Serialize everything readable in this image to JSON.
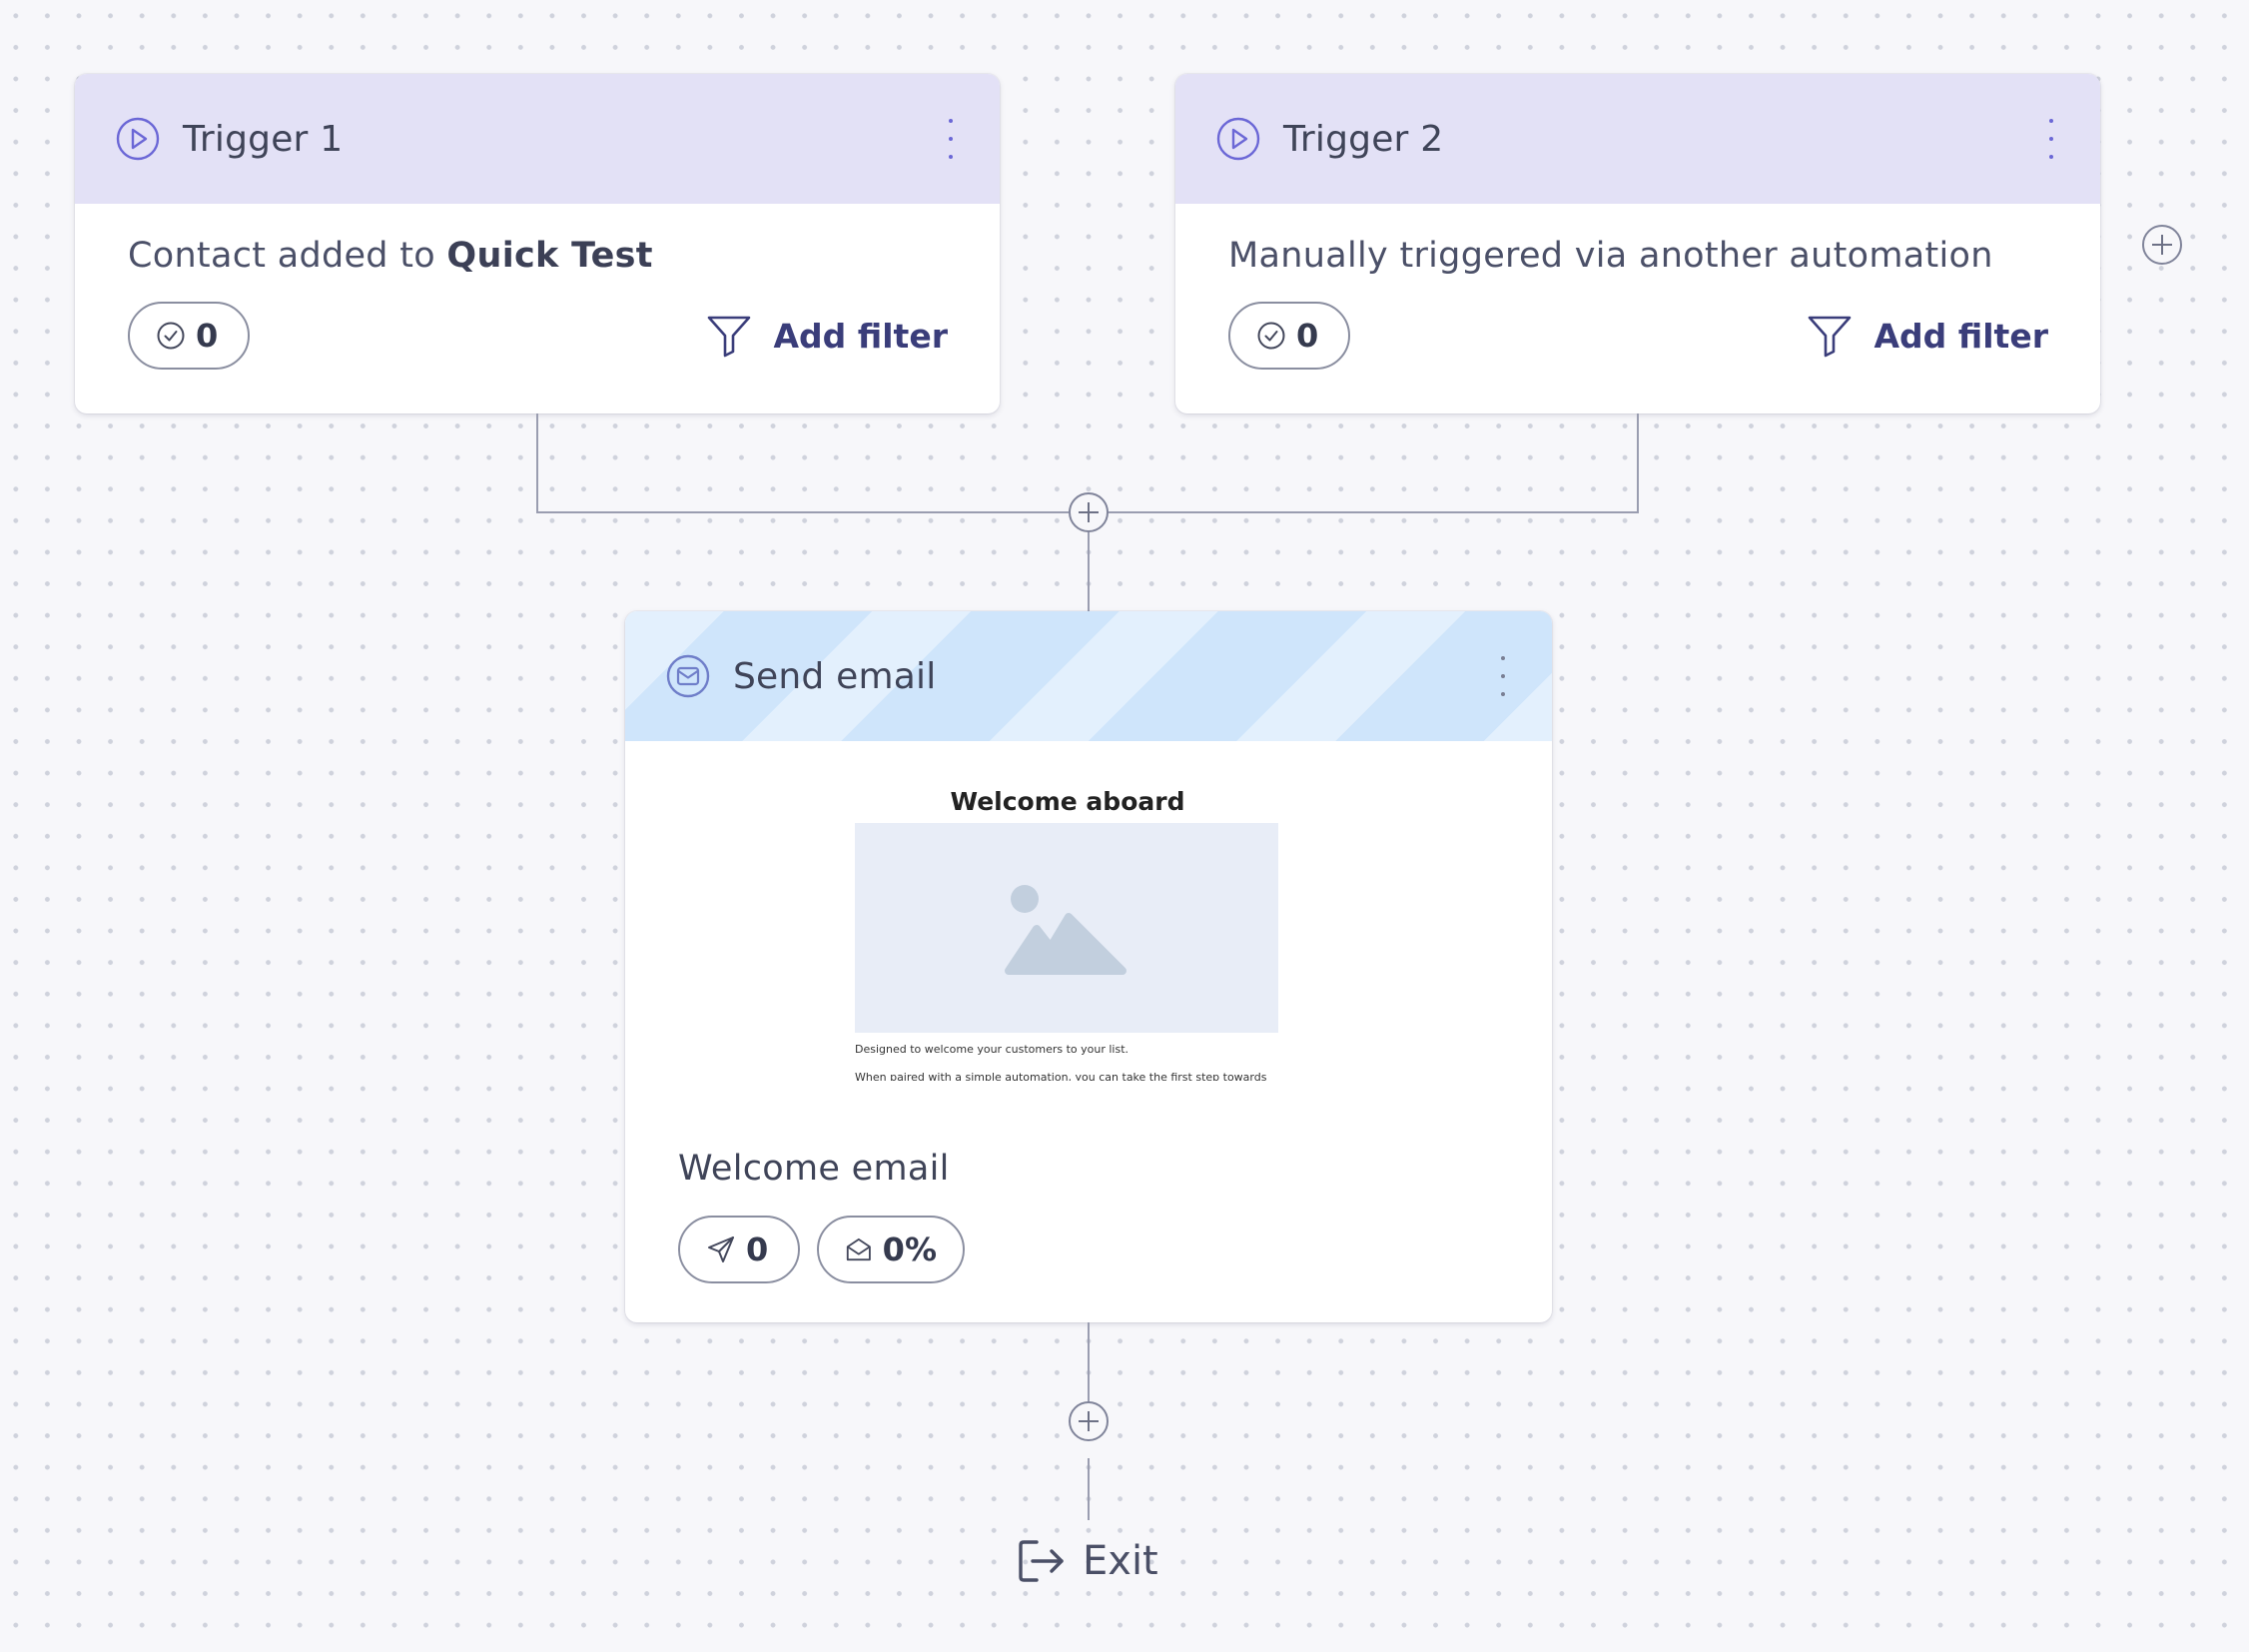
{
  "triggers": [
    {
      "title": "Trigger 1",
      "description_prefix": "Contact added to ",
      "description_bold": "Quick Test",
      "count": "0",
      "add_filter_label": "Add filter"
    },
    {
      "title": "Trigger 2",
      "description_prefix": "Manually triggered via another automation",
      "description_bold": "",
      "count": "0",
      "add_filter_label": "Add filter"
    }
  ],
  "email_step": {
    "title": "Send email",
    "preview_title": "Welcome aboard",
    "preview_text_1": "Designed to welcome your customers to your list.",
    "preview_text_2": "When paired with a simple automation, you can take the first step towards building stronger connections with your audience. From sharing updates and telling your story, to growing your community and boosting your business.",
    "email_name": "Welcome email",
    "sent_count": "0",
    "open_rate": "0%"
  },
  "exit": {
    "label": "Exit"
  },
  "colors": {
    "trigger_header": "#e3e1f6",
    "trigger_accent": "#6b67d6",
    "email_header_stripe_light": "#e3f0fd",
    "email_header_stripe_dark": "#cfe5fb",
    "email_accent": "#6f7ec9",
    "link": "#3a3d7a"
  }
}
